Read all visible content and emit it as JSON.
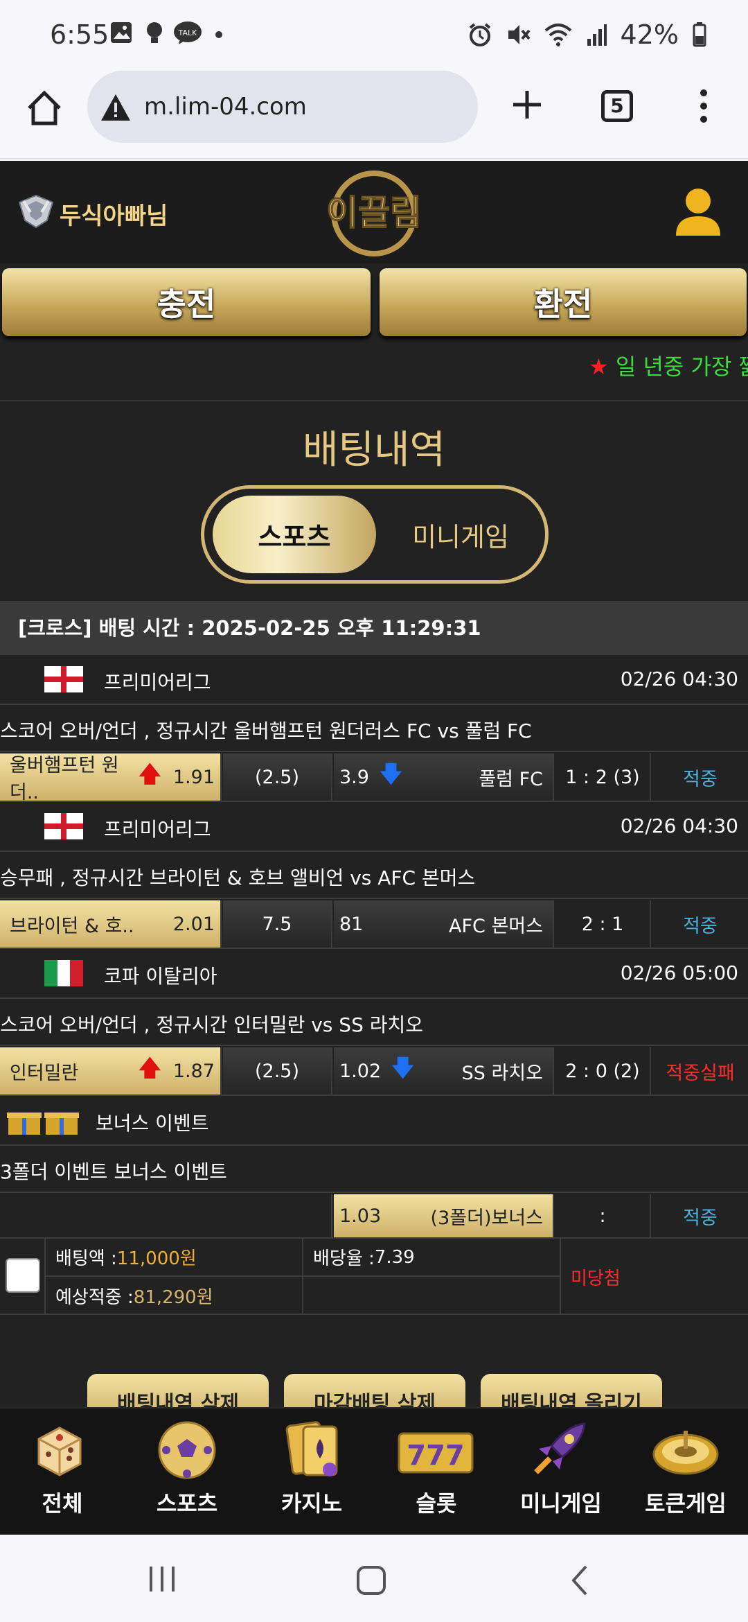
{
  "status": {
    "time": "6:55",
    "battery": "42%"
  },
  "browser": {
    "url": "m.lim-04.com",
    "tab_count": "5"
  },
  "header": {
    "username": "두식아빠님",
    "logo_text": "이끌림"
  },
  "actions": {
    "deposit": "충전",
    "withdraw": "환전"
  },
  "marquee": {
    "star": "★",
    "text": "일 년중 가장 짧"
  },
  "page": {
    "title": "배팅내역"
  },
  "tabs": {
    "sports": "스포츠",
    "minigame": "미니게임"
  },
  "cross": {
    "header": "[크로스] 배팅 시간 : 2025-02-25 오후 11:29:31"
  },
  "bets": [
    {
      "league": "프리미어리그",
      "flag": "england",
      "date": "02/26 04:30",
      "desc": "스코어 오버/언더 , 정규시간 울버햄프턴 원더러스 FC  vs  풀럼 FC",
      "home": "울버햄프턴 원더..",
      "home_odds": "1.91",
      "home_arrow": "up",
      "mid": "(2.5)",
      "away_odds": "3.9",
      "away_arrow": "down",
      "away": "풀럼 FC",
      "score": "1 : 2 (3)",
      "result": "적중",
      "result_type": "hit"
    },
    {
      "league": "프리미어리그",
      "flag": "england",
      "date": "02/26 04:30",
      "desc": "승무패 , 정규시간 브라이턴 & 호브 앨비언  vs  AFC 본머스",
      "home": "브라이턴 & 호..",
      "home_odds": "2.01",
      "home_arrow": "",
      "mid": "7.5",
      "away_odds": "81",
      "away_arrow": "",
      "away": "AFC 본머스",
      "score": "2 : 1",
      "result": "적중",
      "result_type": "hit"
    },
    {
      "league": "코파 이탈리아",
      "flag": "italy",
      "date": "02/26 05:00",
      "desc": "스코어 오버/언더 , 정규시간 인터밀란  vs  SS 라치오",
      "home": "인터밀란",
      "home_odds": "1.87",
      "home_arrow": "up",
      "mid": "(2.5)",
      "away_odds": "1.02",
      "away_arrow": "down",
      "away": "SS 라치오",
      "score": "2 : 0 (2)",
      "result": "적중실패",
      "result_type": "miss"
    }
  ],
  "bonus": {
    "title": "보너스 이벤트",
    "desc": "3폴더 이벤트 보너스 이벤트",
    "odds": "1.03",
    "label": "(3폴더)보너스",
    "score": ":",
    "result": "적중"
  },
  "summary": {
    "bet_amount_label": "배팅액 :",
    "bet_amount": "11,000원",
    "odds_label": "배당율 :",
    "odds": "7.39",
    "expected_label": "예상적중 :",
    "expected": "81,290원",
    "status": "미당첨"
  },
  "buttons": {
    "delete_history": "배팅내역 삭제",
    "delete_closed": "마감배팅 삭제",
    "post_history": "배팅내역 올리기"
  },
  "nav": [
    {
      "label": "전체",
      "icon": "dice-icon"
    },
    {
      "label": "스포츠",
      "icon": "soccer-ball-icon"
    },
    {
      "label": "카지노",
      "icon": "cards-icon"
    },
    {
      "label": "슬롯",
      "icon": "slot-777-icon"
    },
    {
      "label": "미니게임",
      "icon": "rocket-icon"
    },
    {
      "label": "토큰게임",
      "icon": "roulette-icon"
    }
  ],
  "colors": {
    "gold": "#d2b874",
    "hit": "#4ab0d9",
    "miss": "#ff2a2a",
    "amount": "#f0b030"
  }
}
